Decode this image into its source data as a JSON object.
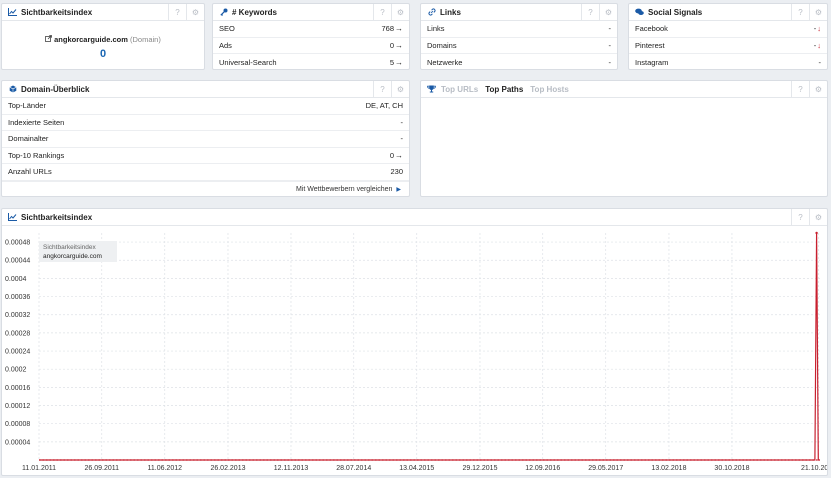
{
  "widgets": {
    "sichtbarkeit_small": {
      "title": "Sichtbarkeitsindex",
      "domain": "angkorcarguide.com",
      "domain_suffix": "(Domain)",
      "value": "0",
      "icon": "line-chart-icon"
    },
    "keywords": {
      "title": "# Keywords",
      "rows": [
        {
          "label": "SEO",
          "value": "768"
        },
        {
          "label": "Ads",
          "value": "0"
        },
        {
          "label": "Universal-Search",
          "value": "5"
        }
      ],
      "icon": "key-icon"
    },
    "links": {
      "title": "Links",
      "rows": [
        {
          "label": "Links",
          "value": "-"
        },
        {
          "label": "Domains",
          "value": "-"
        },
        {
          "label": "Netzwerke",
          "value": "-"
        }
      ],
      "icon": "link-icon"
    },
    "social": {
      "title": "Social Signals",
      "rows": [
        {
          "label": "Facebook",
          "value": "-"
        },
        {
          "label": "Pinterest",
          "value": "-"
        },
        {
          "label": "Instagram",
          "value": "-"
        }
      ],
      "icon": "chat-bubbles-icon"
    },
    "domain_overview": {
      "title": "Domain-Überblick",
      "rows": [
        {
          "label": "Top-Länder",
          "value": "DE, AT, CH"
        },
        {
          "label": "Indexierte Seiten",
          "value": "-"
        },
        {
          "label": "Domainalter",
          "value": "-"
        },
        {
          "label": "Top-10 Rankings",
          "value": "0"
        },
        {
          "label": "Anzahl URLs",
          "value": "230"
        }
      ],
      "compare_link": "Mit Wettbewerbern vergleichen",
      "icon": "cube-icon"
    },
    "top_tabs": {
      "tabs": [
        "Top URLs",
        "Top Paths",
        "Top Hosts"
      ],
      "active": "Top Paths",
      "icon": "trophy-icon"
    },
    "chart_widget": {
      "title": "Sichtbarkeitsindex",
      "legend_title": "Sichtbarkeitsindex",
      "legend_domain": "angkorcarguide.com"
    },
    "help_glyph": "?",
    "gear_glyph": "⚙"
  },
  "colors": {
    "accent": "#1a5aa6",
    "value_blue": "#1a66b3",
    "series_red": "#c8202f",
    "background": "#ebeef2"
  },
  "chart_data": {
    "type": "line",
    "series": [
      {
        "name": "angkorcarguide.com",
        "x": [
          "2011-01-11",
          "2019-10-06",
          "2019-10-13",
          "2019-10-20",
          "2019-10-27"
        ],
        "values": [
          0,
          0,
          0.0005,
          0,
          0
        ]
      }
    ],
    "x_ticks": [
      "11.01.2011",
      "26.09.2011",
      "11.06.2012",
      "26.02.2013",
      "12.11.2013",
      "28.07.2014",
      "13.04.2015",
      "29.12.2015",
      "12.09.2016",
      "29.05.2017",
      "13.02.2018",
      "30.10.2018",
      "21.10.2019"
    ],
    "y_ticks": [
      "0.00048",
      "0.00044",
      "0.0004",
      "0.00036",
      "0.00032",
      "0.00028",
      "0.00024",
      "0.0002",
      "0.00016",
      "0.00012",
      "0.00008",
      "0.00004"
    ],
    "ylim": [
      0,
      0.0005
    ],
    "xlim": [
      "2011-01-11",
      "2019-10-27"
    ],
    "grid": true,
    "xlabel": "",
    "ylabel": ""
  }
}
